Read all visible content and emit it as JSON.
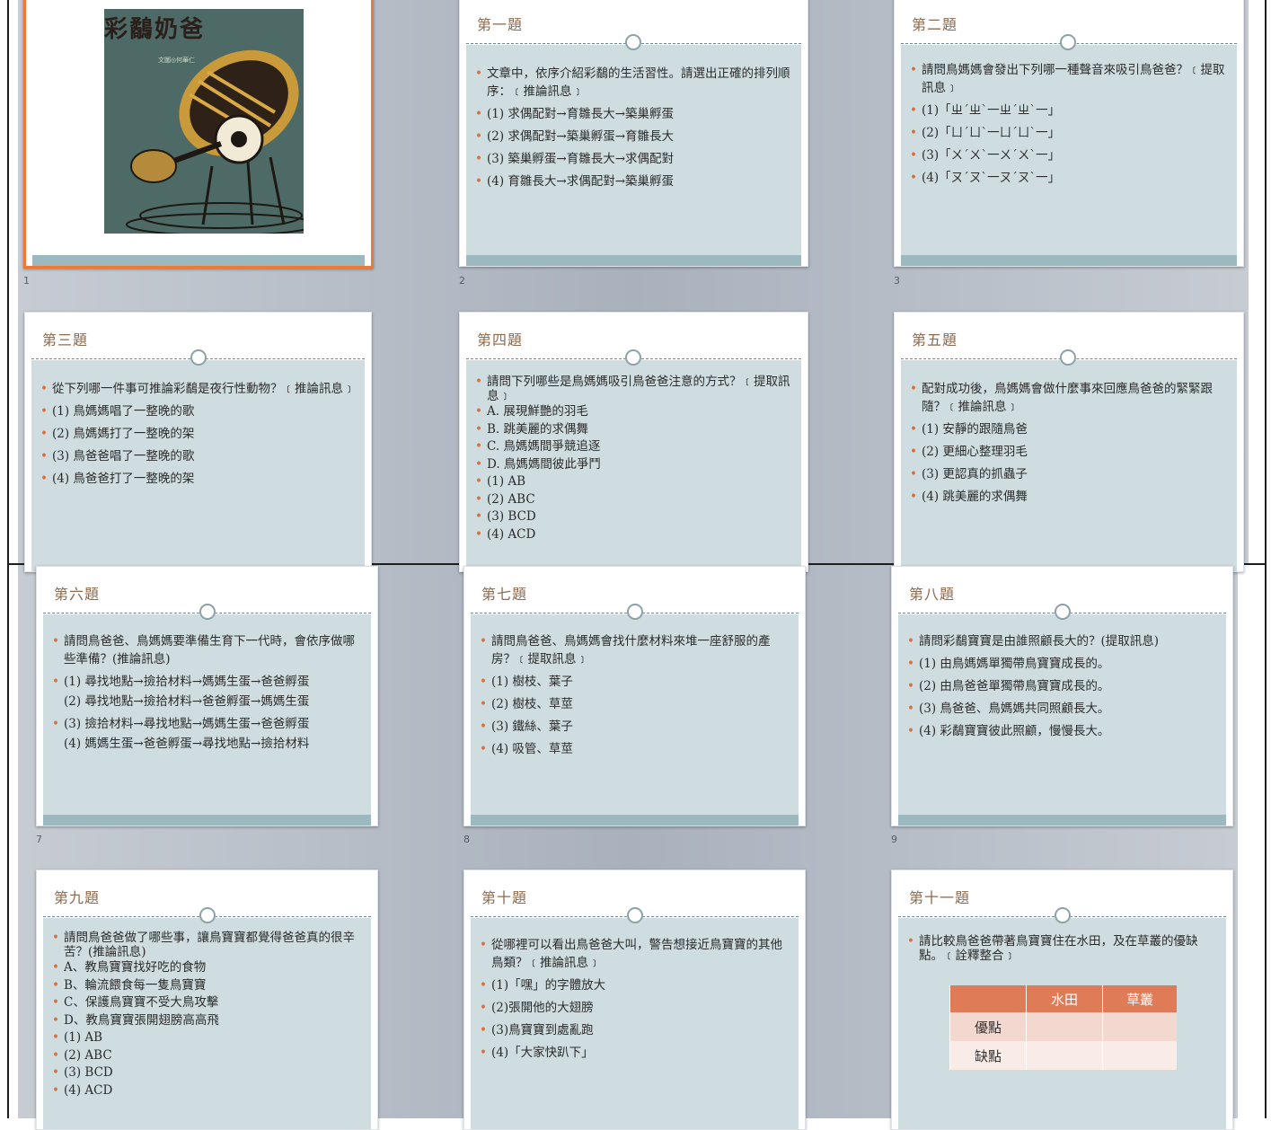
{
  "slide_numbers": [
    "1",
    "2",
    "3",
    "7",
    "8",
    "9"
  ],
  "cover": {
    "title": "彩鷸奶爸",
    "author": "文圖◎何華仁"
  },
  "slides": {
    "s2": {
      "title": "第一題",
      "items": [
        "文章中，依序介紹彩鷸的生活習性。請選出正確的排列順序：﹝推論訊息﹞",
        "(1) 求偶配對→育雛長大→築巢孵蛋",
        "(2) 求偶配對→築巢孵蛋→育雛長大",
        "(3) 築巢孵蛋→育雛長大→求偶配對",
        "(4) 育雛長大→求偶配對→築巢孵蛋"
      ]
    },
    "s3": {
      "title": "第二題",
      "items": [
        "請問鳥媽媽會發出下列哪一種聲音來吸引鳥爸爸？﹝提取訊息﹞",
        "(1)「ㄓˊㄓˋ一ㄓˊㄓˋ一」",
        "(2)「ㄩˊㄩˋ一ㄩˊㄩˋ一」",
        "(3)「ㄨˊㄨˋ一ㄨˊㄨˋ一」",
        "(4)「ㄡˊㄡˋ一ㄡˊㄡˋ一」"
      ]
    },
    "s4": {
      "title": "第三題",
      "items": [
        "從下列哪一件事可推論彩鷸是夜行性動物？﹝推論訊息﹞",
        "(1) 鳥媽媽唱了一整晚的歌",
        "(2) 鳥媽媽打了一整晚的架",
        "(3) 鳥爸爸唱了一整晚的歌",
        "(4) 鳥爸爸打了一整晚的架"
      ]
    },
    "s5": {
      "title": "第四題",
      "items": [
        "請問下列哪些是鳥媽媽吸引鳥爸爸注意的方式？﹝提取訊息﹞",
        "A. 展現鮮艷的羽毛",
        "B. 跳美麗的求偶舞",
        "C. 鳥媽媽間爭競追逐",
        "D. 鳥媽媽間彼此爭鬥",
        "(1) AB",
        "(2) ABC",
        "(3) BCD",
        "(4) ACD"
      ]
    },
    "s6": {
      "title": "第五題",
      "items": [
        "配對成功後，鳥媽媽會做什麼事來回應鳥爸爸的緊緊跟隨？﹝推論訊息﹞",
        "(1) 安靜的跟隨鳥爸",
        "(2) 更細心整理羽毛",
        "(3) 更認真的抓蟲子",
        "(4) 跳美麗的求偶舞"
      ]
    },
    "s7": {
      "title": "第六題",
      "items": [
        "請問鳥爸爸、鳥媽媽要準備生育下一代時，會依序做哪些準備？(推論訊息)",
        "(1) 尋找地點→撿拾材料→媽媽生蛋→爸爸孵蛋",
        "(2) 尋找地點→撿拾材料→爸爸孵蛋→媽媽生蛋",
        "(3) 撿拾材料→尋找地點→媽媽生蛋→爸爸孵蛋",
        "(4) 媽媽生蛋→爸爸孵蛋→尋找地點→撿拾材料"
      ]
    },
    "s8": {
      "title": "第七題",
      "items": [
        "請問鳥爸爸、鳥媽媽會找什麼材料來堆一座舒服的產房？﹝提取訊息﹞",
        "(1) 樹枝、葉子",
        "(2) 樹枝、草莖",
        "(3) 鐵絲、葉子",
        "(4) 吸管、草莖"
      ]
    },
    "s9": {
      "title": "第八題",
      "items": [
        "請問彩鷸寶寶是由誰照顧長大的？(提取訊息)",
        "(1) 由鳥媽媽單獨帶鳥寶寶成長的。",
        "(2) 由鳥爸爸單獨帶鳥寶寶成長的。",
        "(3) 鳥爸爸、鳥媽媽共同照顧長大。",
        "(4) 彩鷸寶寶彼此照顧，慢慢長大。"
      ]
    },
    "s10": {
      "title": "第九題",
      "items": [
        "請問鳥爸爸做了哪些事，讓鳥寶寶都覺得爸爸真的很辛苦？(推論訊息)",
        "A、教鳥寶寶找好吃的食物",
        "B、輪流餵食每一隻鳥寶寶",
        "C、保護鳥寶寶不受大鳥攻擊",
        "D、教鳥寶寶張開翅膀高高飛",
        "(1) AB",
        "(2) ABC",
        "(3) BCD",
        "(4) ACD"
      ]
    },
    "s11": {
      "title": "第十題",
      "items": [
        "從哪裡可以看出鳥爸爸大叫，警告想接近鳥寶寶的其他鳥類？﹝推論訊息﹞",
        "(1)「嘿」的字體放大",
        "(2)張開他的大翅膀",
        "(3)鳥寶寶到處亂跑",
        "(4)「大家快趴下」"
      ]
    },
    "s12": {
      "title": "第十一題",
      "items": [
        "請比較鳥爸爸帶著鳥寶寶住在水田，及在草叢的優缺點。﹝詮釋整合﹞"
      ],
      "table": {
        "headers": [
          "",
          "水田",
          "草叢"
        ],
        "rows": [
          [
            "優點",
            "",
            ""
          ],
          [
            "缺點",
            "",
            ""
          ]
        ]
      }
    }
  }
}
